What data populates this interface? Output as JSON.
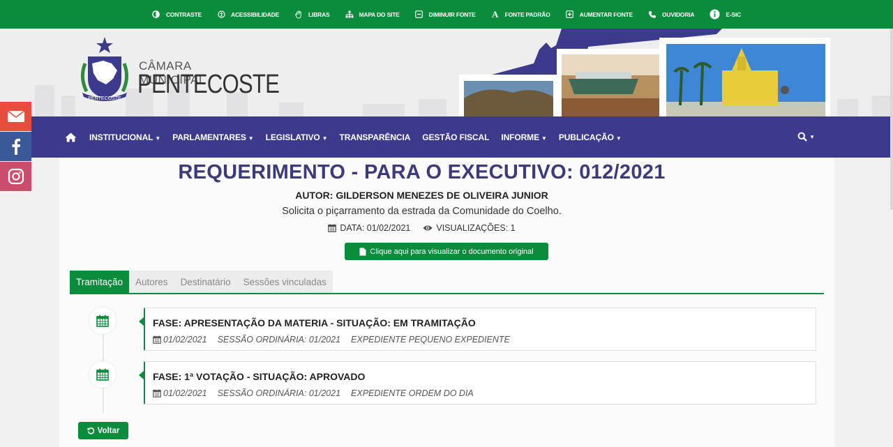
{
  "topbar": {
    "items": [
      {
        "label": "CONTRASTE",
        "icon": "contrast-icon"
      },
      {
        "label": "ACESSIBILIDADE",
        "icon": "accessibility-icon"
      },
      {
        "label": "LIBRAS",
        "icon": "hand-icon"
      },
      {
        "label": "MAPA DO SITE",
        "icon": "sitemap-icon"
      },
      {
        "label": "DIMINUIR FONTE",
        "icon": "minus-square-icon"
      },
      {
        "label": "FONTE PADRÃO",
        "icon": "font-icon"
      },
      {
        "label": "AUMENTAR FONTE",
        "icon": "plus-square-icon"
      },
      {
        "label": "OUVIDORIA",
        "icon": "phone-icon"
      },
      {
        "label": "E-SIC",
        "icon": "info-icon"
      }
    ]
  },
  "header": {
    "logo_line1": "CÂMARA MUNICIPAL",
    "logo_line2": "PENTECOSTE",
    "seal_text": "PENTECOSTE"
  },
  "nav": {
    "items": [
      {
        "label": "INSTITUCIONAL",
        "dropdown": true
      },
      {
        "label": "PARLAMENTARES",
        "dropdown": true
      },
      {
        "label": "LEGISLATIVO",
        "dropdown": true
      },
      {
        "label": "TRANSPARÊNCIA",
        "dropdown": false
      },
      {
        "label": "GESTÃO FISCAL",
        "dropdown": false
      },
      {
        "label": "INFORME",
        "dropdown": true
      },
      {
        "label": "PUBLICAÇÃO",
        "dropdown": true
      }
    ]
  },
  "doc": {
    "title": "REQUERIMENTO - PARA O EXECUTIVO: 012/2021",
    "author": "AUTOR: GILDERSON MENEZES DE OLIVEIRA JUNIOR",
    "description": "Solicita o piçarramento da estrada da Comunidade do Coelho.",
    "date": "DATA: 01/02/2021",
    "views": "VISUALIZAÇÕES: 1",
    "view_button": "Clique aqui para visualizar o documento original"
  },
  "tabs": [
    "Tramitação",
    "Autores",
    "Destinatário",
    "Sessões vinculadas"
  ],
  "timeline": [
    {
      "title": "FASE: APRESENTAÇÃO DA MATERIA - SITUAÇÃO: EM TRAMITAÇÃO",
      "date": "01/02/2021",
      "session": "SESSÃO ORDINÁRIA: 01/2021",
      "expediente": "EXPEDIENTE PEQUENO EXPEDIENTE"
    },
    {
      "title": "FASE: 1ª VOTAÇÃO - SITUAÇÃO: APROVADO",
      "date": "01/02/2021",
      "session": "SESSÃO ORDINÁRIA: 01/2021",
      "expediente": "EXPEDIENTE ORDEM DO DIA"
    }
  ],
  "back_button": "Voltar",
  "colors": {
    "green": "#0a8c3c",
    "navy": "#3c3a8c",
    "title": "#3c3a7a"
  }
}
